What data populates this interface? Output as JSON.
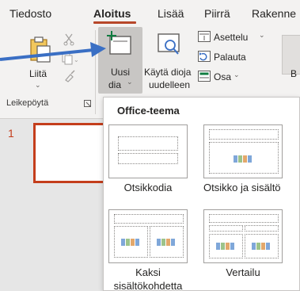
{
  "tabs": [
    {
      "label": "Tiedosto",
      "active": false
    },
    {
      "label": "Aloitus",
      "active": true
    },
    {
      "label": "Lisää",
      "active": false
    },
    {
      "label": "Piirrä",
      "active": false
    },
    {
      "label": "Rakenne",
      "active": false
    }
  ],
  "ribbon": {
    "clipboard": {
      "paste_label": "Liitä",
      "group_label": "Leikepöytä"
    },
    "slides": {
      "new_slide_line1": "Uusi",
      "new_slide_line2": "dia",
      "reuse_line1": "Käytä dioja",
      "reuse_line2": "uudelleen",
      "layout_label": "Asettelu",
      "reset_label": "Palauta",
      "section_label": "Osa"
    },
    "partial_right_label": "B"
  },
  "slide_pane": {
    "slide_number": "1"
  },
  "layout_dropdown": {
    "title": "Office-teema",
    "layouts": [
      {
        "name": "Otsikkodia"
      },
      {
        "name": "Otsikko ja sisältö"
      },
      {
        "name_line1": "Kaksi",
        "name_line2": "sisältökohdetta"
      },
      {
        "name": "Vertailu"
      }
    ]
  },
  "colors": {
    "accent": "#b7472a",
    "arrow": "#3a6fc4",
    "selected_slide_border": "#c43e1c"
  }
}
